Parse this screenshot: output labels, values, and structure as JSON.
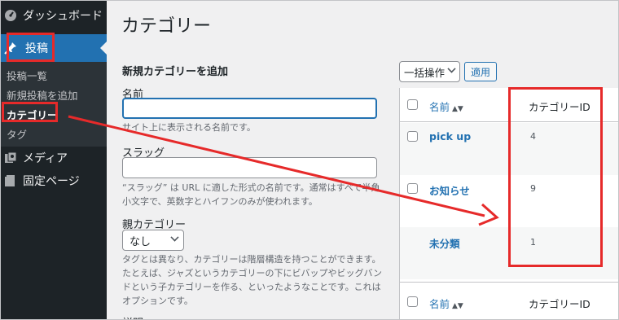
{
  "sidebar": {
    "dashboard": "ダッシュボード",
    "posts": "投稿",
    "submenu": [
      "投稿一覧",
      "新規投稿を追加",
      "カテゴリー",
      "タグ"
    ],
    "media": "メディア",
    "pages": "固定ページ"
  },
  "page": {
    "title": "カテゴリー"
  },
  "form": {
    "title": "新規カテゴリーを追加",
    "name_label": "名前",
    "name_value": "",
    "name_help": "サイト上に表示される名前です。",
    "slug_label": "スラッグ",
    "slug_value": "",
    "slug_help": "“スラッグ” は URL に適した形式の名前です。通常はすべて半角小文字で、英数字とハイフンのみが使われます。",
    "parent_label": "親カテゴリー",
    "parent_value": "なし",
    "parent_help": "タグとは異なり、カテゴリーは階層構造を持つことができます。たとえば、ジャズというカテゴリーの下にビバップやビッグバンドという子カテゴリーを作る、といったようなことです。これはオプションです。",
    "desc_label": "説明"
  },
  "list": {
    "bulk_action": "一括操作",
    "apply": "適用",
    "col_name": "名前",
    "col_id": "カテゴリーID",
    "sort_icon": "sort-arrows-icon",
    "rows": [
      {
        "name": "pick up",
        "id": "4",
        "checkbox": true
      },
      {
        "name": "お知らせ",
        "id": "9",
        "checkbox": true
      },
      {
        "name": "未分類",
        "id": "1",
        "checkbox": false
      }
    ]
  },
  "colors": {
    "highlight": "#e62a2a",
    "sidebar_bg": "#1d2327",
    "active": "#2271b1",
    "link": "#2271b1"
  }
}
